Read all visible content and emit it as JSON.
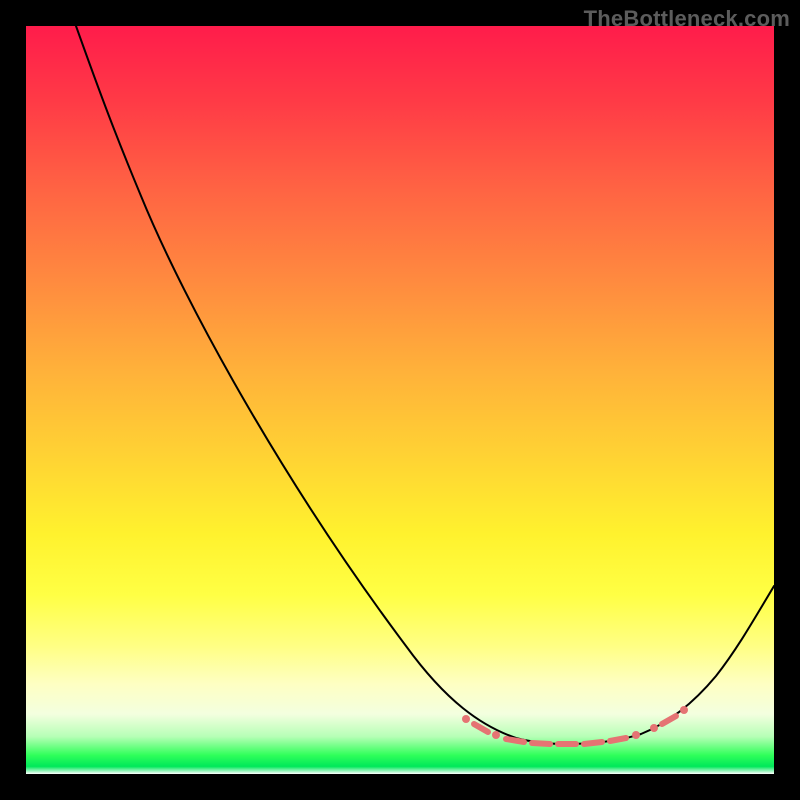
{
  "watermark": "TheBottleneck.com",
  "chart_data": {
    "type": "line",
    "title": "",
    "xlabel": "",
    "ylabel": "",
    "x": [
      0.07,
      0.12,
      0.18,
      0.25,
      0.33,
      0.42,
      0.51,
      0.58,
      0.63,
      0.68,
      0.72,
      0.76,
      0.8,
      0.84,
      0.88,
      0.92,
      0.96,
      1.0
    ],
    "y": [
      1.0,
      0.88,
      0.77,
      0.63,
      0.48,
      0.33,
      0.17,
      0.09,
      0.06,
      0.04,
      0.04,
      0.04,
      0.04,
      0.05,
      0.07,
      0.12,
      0.19,
      0.25
    ],
    "highlight_range_x": [
      0.59,
      0.88
    ],
    "background_gradient": {
      "top": "#ff1c4b",
      "mid": "#fff22e",
      "bottom": "#00e85a"
    },
    "frame_color": "#000000",
    "marker_color": "#e57373"
  }
}
